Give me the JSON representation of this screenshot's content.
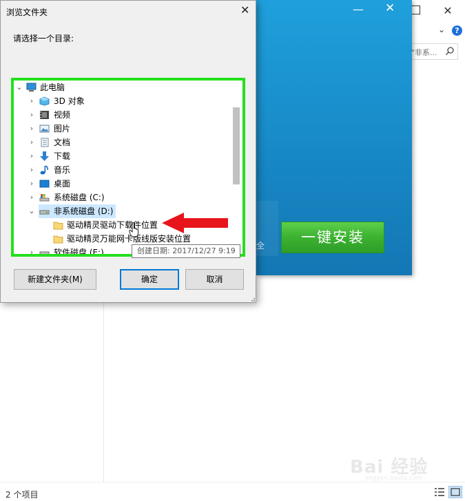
{
  "explorer": {
    "search_placeholder": "\"非系...",
    "status_count": "2 个项目",
    "close_glyph": "✕",
    "chevron_glyph": "⌄",
    "help_glyph": "?"
  },
  "installer": {
    "minimize_glyph": "—",
    "close_glyph": "✕",
    "side_text": "全",
    "install_button_label": "一键安装"
  },
  "dialog": {
    "title": "浏览文件夹",
    "close_glyph": "✕",
    "prompt": "请选择一个目录:",
    "tree": [
      {
        "label": "此电脑",
        "arrow": "⌄",
        "icon": "computer-icon"
      },
      {
        "label": "3D 对象",
        "arrow": "›",
        "icon": "3d-objects-icon"
      },
      {
        "label": "视频",
        "arrow": "›",
        "icon": "video-icon"
      },
      {
        "label": "图片",
        "arrow": "›",
        "icon": "picture-icon"
      },
      {
        "label": "文档",
        "arrow": "›",
        "icon": "document-icon"
      },
      {
        "label": "下载",
        "arrow": "›",
        "icon": "download-icon"
      },
      {
        "label": "音乐",
        "arrow": "›",
        "icon": "music-icon"
      },
      {
        "label": "桌面",
        "arrow": "›",
        "icon": "desktop-icon"
      },
      {
        "label": "系统磁盘 (C:)",
        "arrow": "›",
        "icon": "system-drive-icon"
      },
      {
        "label": "非系统磁盘 (D:)",
        "arrow": "⌄",
        "icon": "drive-icon",
        "selected": true
      },
      {
        "label": "驱动精灵驱动下载件位置",
        "arrow": "",
        "icon": "folder-icon"
      },
      {
        "label": "驱动精灵万能网卡版线版安装位置",
        "arrow": "",
        "icon": "folder-icon"
      },
      {
        "label": "软件磁盘 (E:)",
        "arrow": "›",
        "icon": "drive-icon"
      }
    ],
    "tooltip": "创建日期: 2017/12/27 9:19",
    "buttons": {
      "new_folder": "新建文件夹(M)",
      "ok": "确定",
      "cancel": "取消"
    }
  },
  "watermark": {
    "text": "Bai 经验",
    "sub": "jingyan.baidu.com"
  },
  "colors": {
    "tree_highlight_border": "#24e01e",
    "annotation_arrow": "#e8141b",
    "installer_blue": "#1789c6",
    "install_button_green": "#3bb131"
  }
}
